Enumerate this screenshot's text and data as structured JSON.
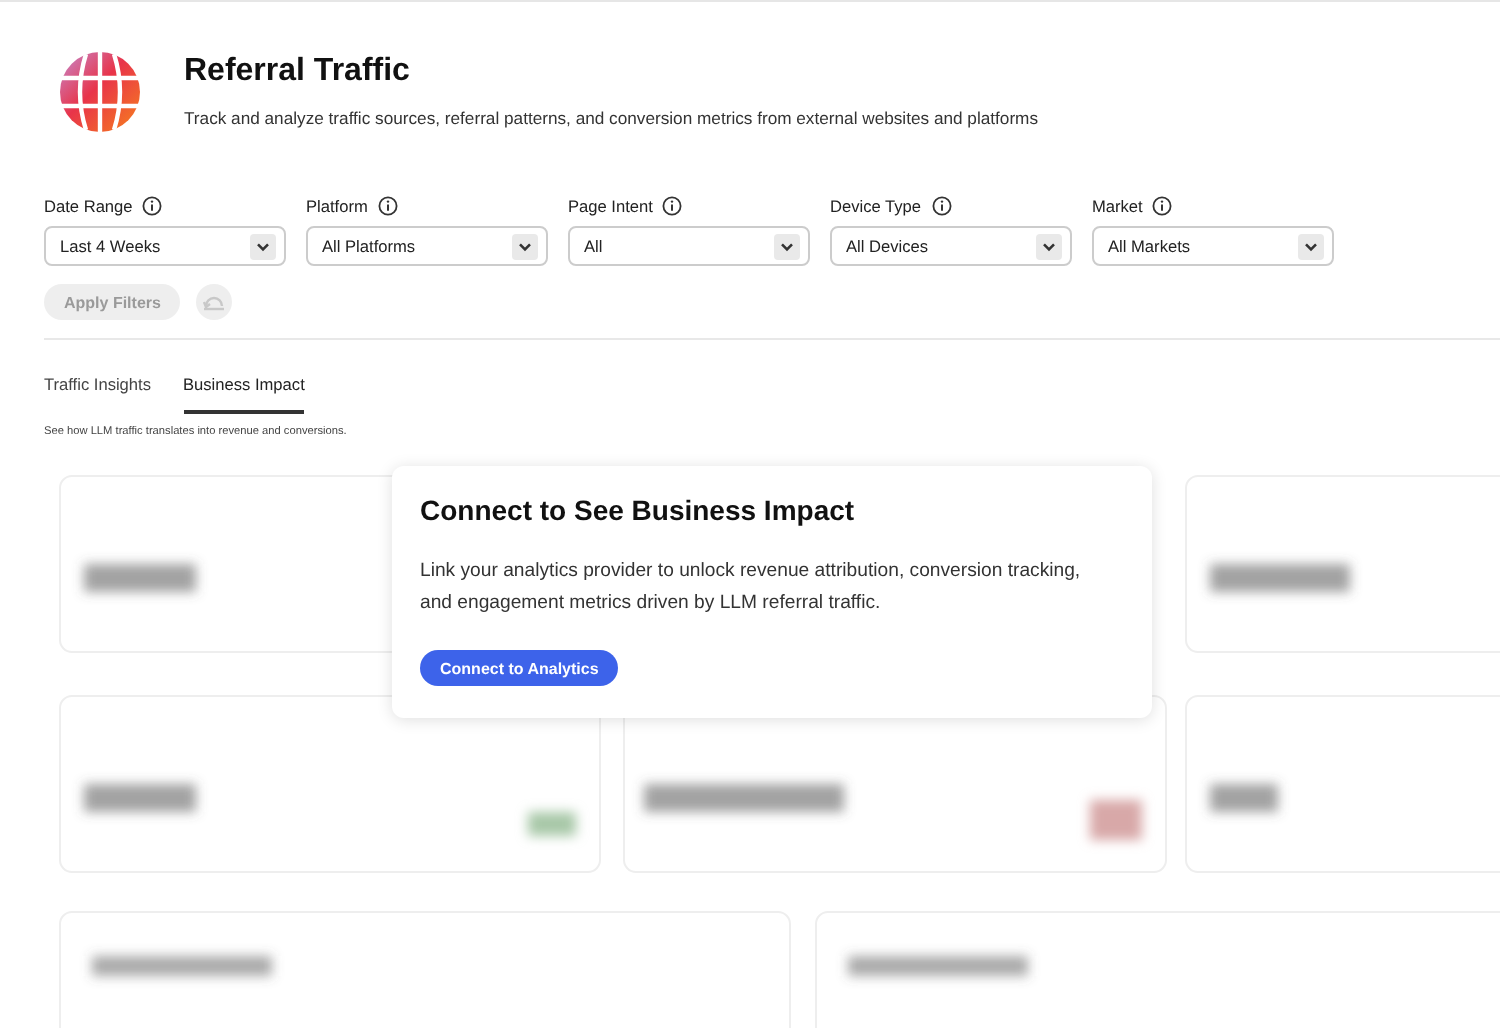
{
  "header": {
    "title": "Referral Traffic",
    "subtitle": "Track and analyze traffic sources, referral patterns, and conversion metrics from external websites and platforms"
  },
  "filters": [
    {
      "label": "Date Range",
      "value": "Last 4 Weeks"
    },
    {
      "label": "Platform",
      "value": "All Platforms"
    },
    {
      "label": "Page Intent",
      "value": "All"
    },
    {
      "label": "Device Type",
      "value": "All Devices"
    },
    {
      "label": "Market",
      "value": "All Markets"
    }
  ],
  "apply_button": {
    "label": "Apply Filters",
    "disabled": true
  },
  "reset_button": {
    "disabled": true
  },
  "tabs": [
    {
      "label": "Traffic Insights",
      "selected": false
    },
    {
      "label": "Business Impact",
      "selected": true
    }
  ],
  "tab_description": "See how LLM traffic translates into revenue and conversions.",
  "dialog": {
    "title": "Connect to See Business Impact",
    "body": "Link your analytics provider to unlock revenue attribution, conversion tracking, and engagement metrics driven by LLM referral traffic.",
    "button": "Connect to Analytics"
  }
}
